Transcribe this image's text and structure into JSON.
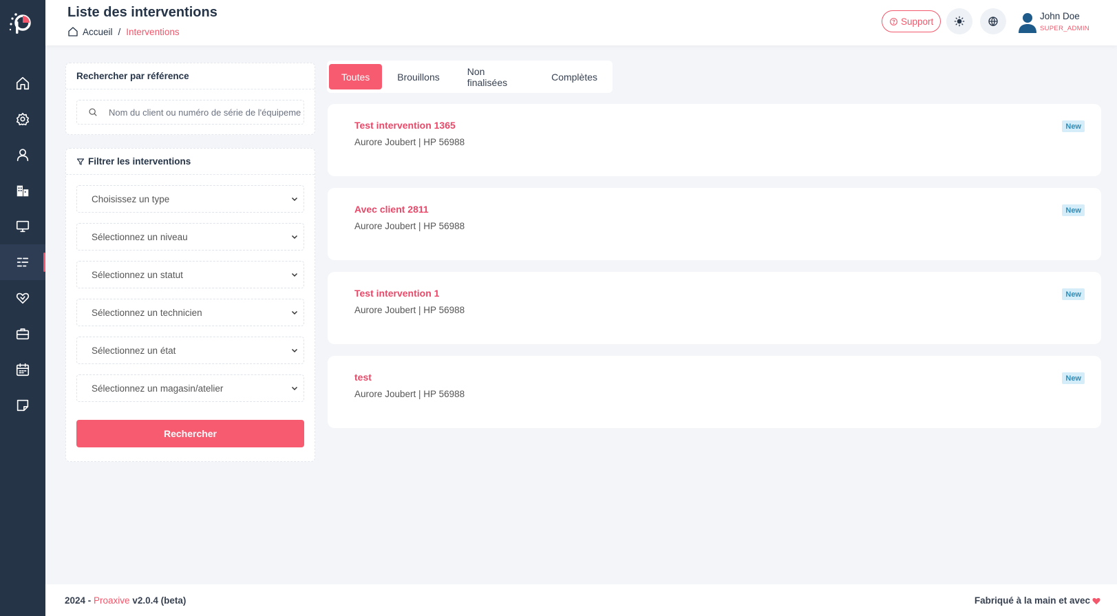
{
  "header": {
    "title": "Liste des interventions",
    "breadcrumb": {
      "home": "Accueil",
      "separator": "/",
      "current": "Interventions"
    },
    "support_label": "Support",
    "user": {
      "name": "John Doe",
      "role": "SUPER_ADMIN"
    }
  },
  "sidebar": {
    "items": [
      {
        "icon": "home-icon"
      },
      {
        "icon": "gear-icon"
      },
      {
        "icon": "user-icon"
      },
      {
        "icon": "buildings-icon"
      },
      {
        "icon": "monitor-icon"
      },
      {
        "icon": "list-icon",
        "active": true
      },
      {
        "icon": "heart-handshake-icon"
      },
      {
        "icon": "briefcase-icon"
      },
      {
        "icon": "calendar-icon"
      },
      {
        "icon": "note-icon"
      }
    ]
  },
  "search_panel": {
    "title": "Rechercher par référence",
    "placeholder": "Nom du client ou numéro de série de l'équipement"
  },
  "filter_panel": {
    "title": "Filtrer les interventions",
    "selects": [
      "Choisissez un type",
      "Sélectionnez un niveau",
      "Sélectionnez un statut",
      "Sélectionnez un technicien",
      "Sélectionnez un état",
      "Sélectionnez un magasin/atelier"
    ],
    "button_label": "Rechercher"
  },
  "tabs": [
    "Toutes",
    "Brouillons",
    "Non finalisées",
    "Complètes"
  ],
  "interventions": [
    {
      "title": "Test intervention 1365",
      "subtitle": "Aurore Joubert | HP 56988",
      "badge": "New"
    },
    {
      "title": "Avec client 2811",
      "subtitle": "Aurore Joubert | HP 56988",
      "badge": "New"
    },
    {
      "title": "Test intervention 1",
      "subtitle": "Aurore Joubert | HP 56988",
      "badge": "New"
    },
    {
      "title": "test",
      "subtitle": "Aurore Joubert | HP 56988",
      "badge": "New"
    }
  ],
  "footer": {
    "year": "2024 - ",
    "brand": "Proaxive",
    "version": " v2.0.4 (beta)",
    "made_with": "Fabriqué à la main et avec"
  },
  "colors": {
    "accent": "#f2576b",
    "sidebar": "#263448",
    "badge_bg": "#d5edf8",
    "badge_text": "#2b8fbd"
  }
}
